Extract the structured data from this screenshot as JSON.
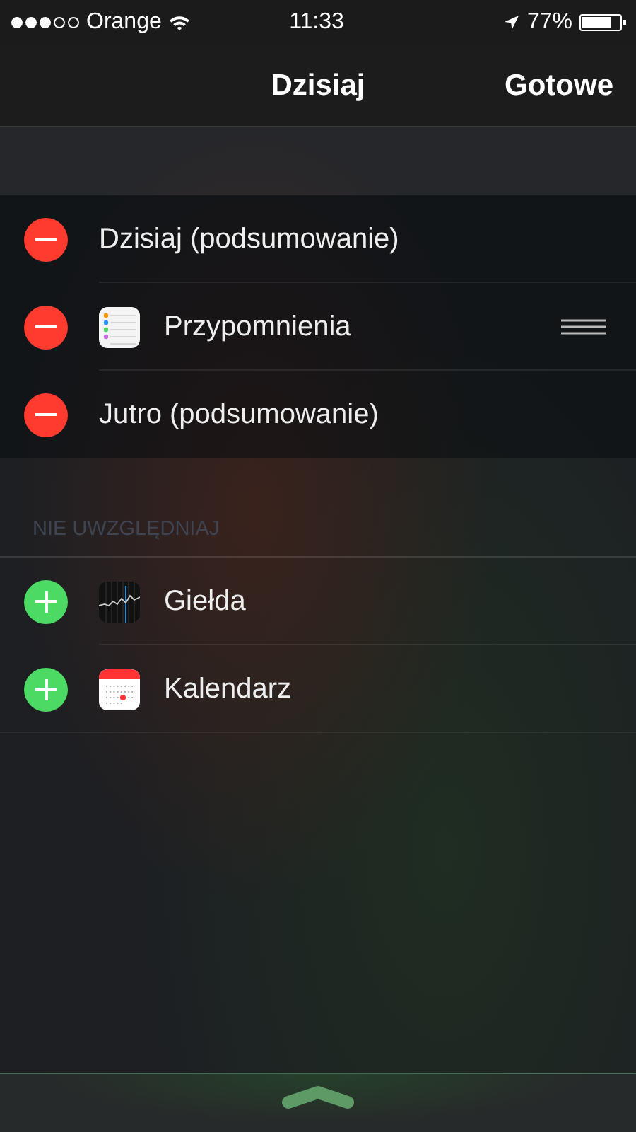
{
  "status_bar": {
    "carrier": "Orange",
    "time": "11:33",
    "battery_text": "77%",
    "battery": {
      "level": 0.77
    }
  },
  "nav": {
    "title": "Dzisiaj",
    "done": "Gotowe"
  },
  "included": [
    {
      "label": "Dzisiaj (podsumowanie)",
      "kind": "summary",
      "reorderable": false
    },
    {
      "label": "Przypomnienia",
      "kind": "reminders",
      "reorderable": true
    },
    {
      "label": "Jutro (podsumowanie)",
      "kind": "summary",
      "reorderable": false
    }
  ],
  "excluded_header": "NIE UWZGLĘDNIAJ",
  "excluded": [
    {
      "label": "Giełda",
      "kind": "stocks"
    },
    {
      "label": "Kalendarz",
      "kind": "calendar"
    }
  ]
}
